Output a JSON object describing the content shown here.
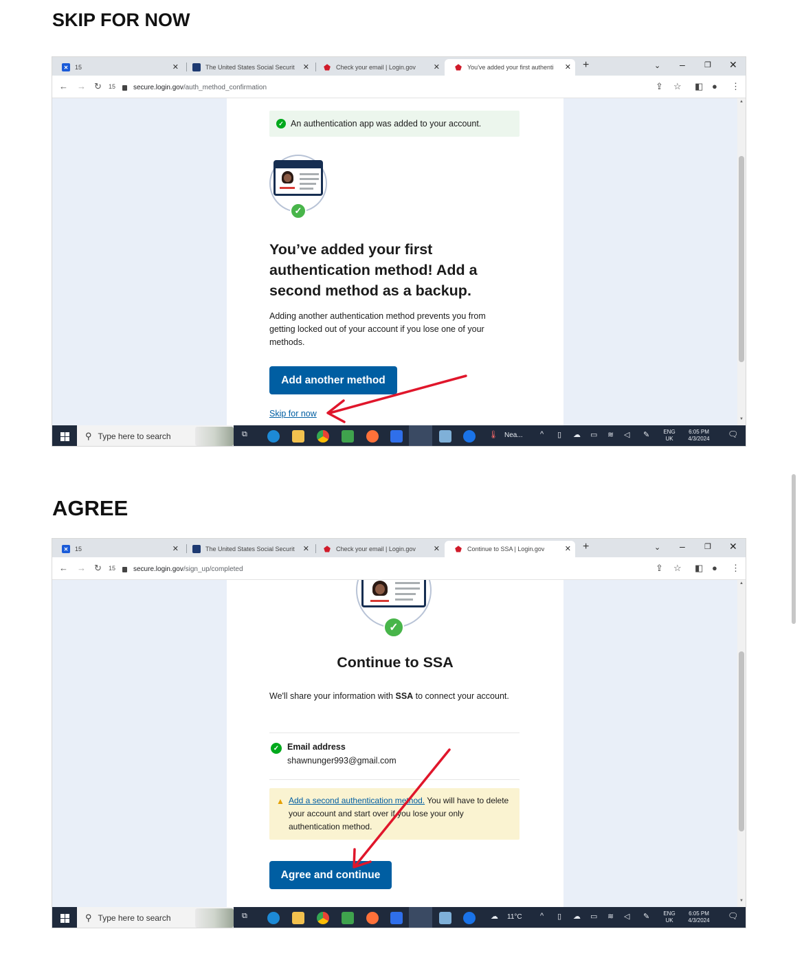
{
  "section1_title": "SKIP FOR NOW",
  "section2_title": "AGREE",
  "browser": {
    "tabs": [
      {
        "label": "15"
      },
      {
        "label": "The United States Social Securit"
      },
      {
        "label": "Check your email | Login.gov"
      }
    ],
    "tab_count": "15"
  },
  "screen1": {
    "active_tab": "You've added your first authenti",
    "url_host": "secure.login.gov",
    "url_path": "/auth_method_confirmation",
    "success_alert": "An authentication app was added to your account.",
    "heading": "You’ve added your first authentication method! Add a second method as a backup.",
    "body": "Adding another authentication method prevents you from getting locked out of your account if you lose one of your methods.",
    "primary_button": "Add another method",
    "skip_link": "Skip for now",
    "taskbar": {
      "search_placeholder": "Type here to search",
      "weather": "Nea...",
      "lang": "ENG",
      "region": "UK",
      "time": "6:05 PM",
      "date": "4/3/2024"
    }
  },
  "screen2": {
    "active_tab": "Continue to SSA | Login.gov",
    "url_host": "secure.login.gov",
    "url_path": "/sign_up/completed",
    "heading": "Continue to SSA",
    "body_pre": "We'll share your information with ",
    "body_bold": "SSA",
    "body_post": " to connect your account.",
    "email_label": "Email address",
    "email_value": "shawnunger993@gmail.com",
    "warning_link": "Add a second authentication method.",
    "warning_text": " You will have to delete your account and start over if you lose your only authentication method.",
    "primary_button": "Agree and continue",
    "taskbar": {
      "search_placeholder": "Type here to search",
      "weather": "11°C",
      "lang": "ENG",
      "region": "UK",
      "time": "6:05 PM",
      "date": "4/3/2024"
    }
  },
  "colors": {
    "primary_blue": "#005ea2",
    "success_green": "#00a91c",
    "annotation_red": "#e0162b",
    "warning_bg": "#faf3d1",
    "success_bg": "#ecf6ed"
  }
}
